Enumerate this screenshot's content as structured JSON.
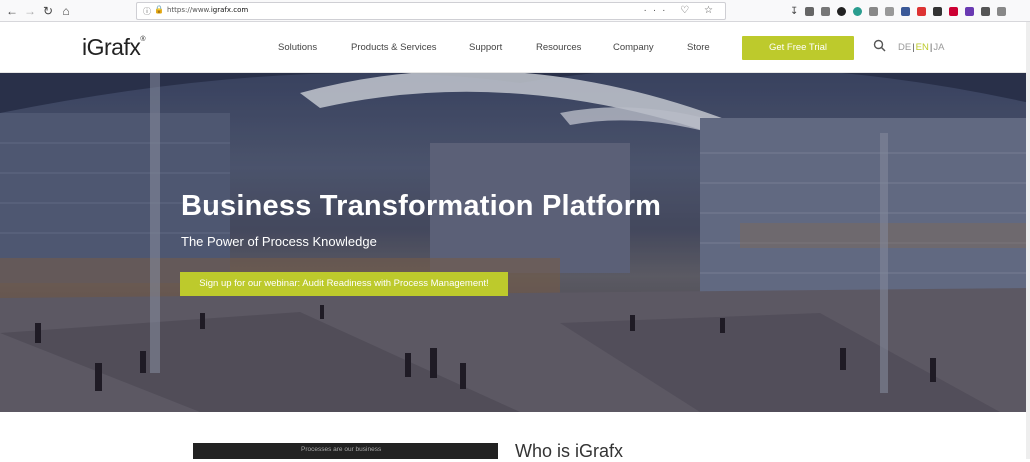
{
  "browser": {
    "url_scheme": "https://www.",
    "url_host": "igrafx.com",
    "nav_icons": [
      "back-icon",
      "forward-icon",
      "reload-icon",
      "home-icon"
    ],
    "url_action_icons": "··· ♡ ☆"
  },
  "header": {
    "logo": "iGrafx",
    "logo_mark": "®",
    "nav": [
      "Solutions",
      "Products & Services",
      "Support",
      "Resources",
      "Company",
      "Store"
    ],
    "cta": "Get Free Trial",
    "languages": [
      "DE",
      "EN",
      "JA"
    ],
    "active_language": "EN",
    "accent_color": "#bdca2c"
  },
  "hero": {
    "title": "Business Transformation Platform",
    "subtitle": "The Power of Process Knowledge",
    "button": "Sign up for our webinar: Audit Readiness with Process Management!"
  },
  "about": {
    "video_caption": "Processes are our business",
    "title": "Who is iGrafx"
  }
}
